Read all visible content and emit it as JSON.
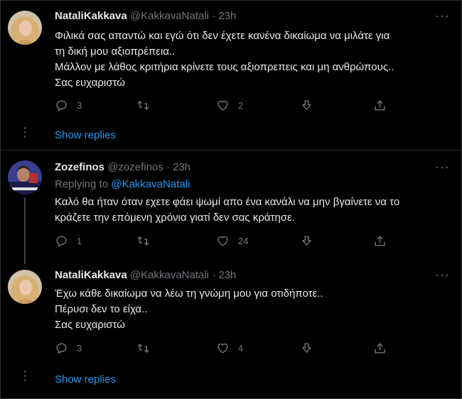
{
  "tweets": [
    {
      "name": "NataliKakkava",
      "handle": "@KakkavaNatali",
      "sep": "·",
      "time": "23h",
      "more": "···",
      "lines": [
        "Φιλικά σας απαντώ και εγώ ότι δεν έχετε κανένα δικαίωμα να μιλάτε για",
        "τη δική μου αξιοπρέπεια..",
        "Μάλλον με λάθος κριτήρια κρίνετε τους αξιοπρεπεις και μη ανθρώπους..",
        "Σας ευχαριστώ"
      ],
      "replies": "3",
      "retweets": "",
      "likes": "2",
      "show_replies": "Show replies"
    },
    {
      "name": "Zozefinos",
      "handle": "@zozefinos",
      "sep": "·",
      "time": "23h",
      "more": "···",
      "replying_label": "Replying to",
      "replying_to": "@KakkavaNatali",
      "lines": [
        "Καλό θα ήταν όταν εχετε φάει ψωμί απο ένα κανάλι να μην βγαίνετε να το",
        "κράζετε την επόμενη χρόνια γιατί δεν σας κράτησε."
      ],
      "replies": "1",
      "retweets": "",
      "likes": "24"
    },
    {
      "name": "NataliKakkava",
      "handle": "@KakkavaNatali",
      "sep": "·",
      "time": "23h",
      "more": "···",
      "lines": [
        "Έχω κάθε δικαίωμα να λέω τη γνώμη μου για οτιδήποτε..",
        "Πέρυσι δεν το είχα..",
        "Σας ευχαριστώ"
      ],
      "replies": "3",
      "retweets": "",
      "likes": "4",
      "show_replies": "Show replies"
    }
  ],
  "colors": {
    "background": "#000000",
    "link": "#1d9bf0",
    "muted": "#71767b",
    "text": "#e7e9ea"
  },
  "icons": [
    "reply-icon",
    "retweet-icon",
    "like-icon",
    "download-icon",
    "share-icon",
    "more-icon"
  ]
}
